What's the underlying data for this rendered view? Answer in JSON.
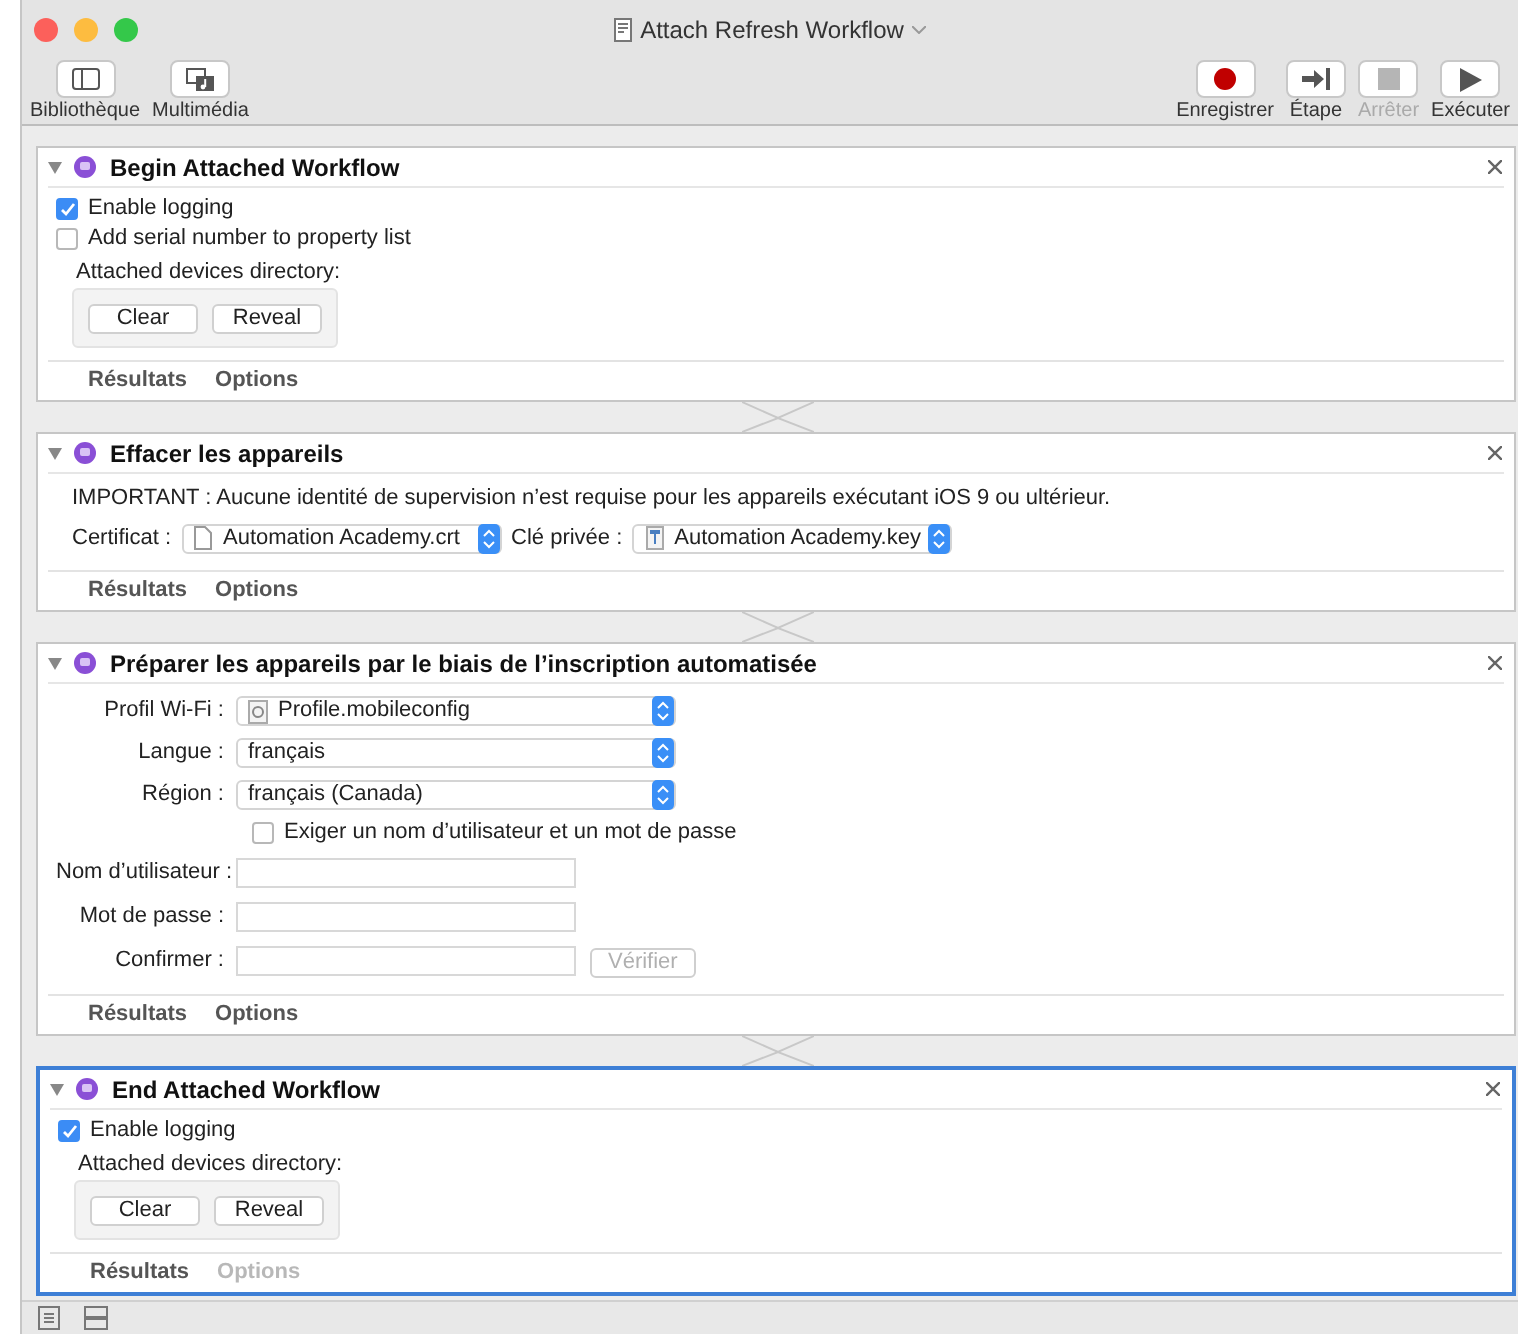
{
  "window": {
    "title": "Attach Refresh Workflow"
  },
  "toolbar_left": [
    {
      "label": "Bibliothèque",
      "kind": "library"
    },
    {
      "label": "Multimédia",
      "kind": "media"
    }
  ],
  "toolbar_right": [
    {
      "label": "Enregistrer",
      "kind": "record",
      "disabled": false
    },
    {
      "label": "Étape",
      "kind": "step",
      "disabled": false
    },
    {
      "label": "Arrêter",
      "kind": "stop",
      "disabled": true
    },
    {
      "label": "Exécuter",
      "kind": "run",
      "disabled": false
    }
  ],
  "actions": [
    {
      "title": "Begin Attached Workflow",
      "selected": false,
      "items": [
        {
          "kind": "checkbox",
          "label": "Enable logging",
          "checked": true
        },
        {
          "kind": "checkbox",
          "label": "Add serial number to property list",
          "checked": false
        },
        {
          "kind": "directory",
          "label": "Attached devices directory:",
          "buttons": [
            "Clear",
            "Reveal"
          ]
        }
      ],
      "tabs": [
        {
          "label": "Résultats",
          "disabled": false
        },
        {
          "label": "Options",
          "disabled": false
        }
      ]
    },
    {
      "title": "Effacer les appareils",
      "selected": false,
      "items": [
        {
          "kind": "text",
          "text": "IMPORTANT : Aucune identité de supervision n’est requise pour les appareils exécutant iOS 9 ou ultérieur."
        },
        {
          "kind": "popup-pair",
          "fields": [
            {
              "label": "Certificat :",
              "value": "Automation Academy.crt",
              "icon": {
                "kind": "document"
              }
            },
            {
              "label": "Clé privée :",
              "value": "Automation Academy.key",
              "icon": {
                "kind": "key"
              }
            }
          ]
        }
      ],
      "tabs": [
        {
          "label": "Résultats",
          "disabled": false
        },
        {
          "label": "Options",
          "disabled": false
        }
      ]
    },
    {
      "title": "Préparer les appareils par le biais de l’inscription automatisée",
      "selected": false,
      "items": [
        {
          "kind": "popup",
          "label": "Profil Wi-Fi :",
          "value": "Profile.mobileconfig",
          "icon": {
            "kind": "config"
          }
        },
        {
          "kind": "popup",
          "label": "Langue :",
          "value": "français"
        },
        {
          "kind": "popup",
          "label": "Région :",
          "value": "français (Canada)"
        },
        {
          "kind": "form-checkbox",
          "label": "Exiger un nom d’utilisateur et un mot de passe",
          "checked": false
        },
        {
          "kind": "field",
          "label": "Nom d’utilisateur :"
        },
        {
          "kind": "field",
          "label": "Mot de passe :"
        },
        {
          "kind": "field",
          "label": "Confirmer :",
          "button": {
            "label": "Vérifier",
            "disabled": true
          }
        }
      ],
      "tabs": [
        {
          "label": "Résultats",
          "disabled": false
        },
        {
          "label": "Options",
          "disabled": false
        }
      ]
    },
    {
      "title": "End Attached Workflow",
      "selected": true,
      "items": [
        {
          "kind": "checkbox",
          "label": "Enable logging",
          "checked": true
        },
        {
          "kind": "directory",
          "label": "Attached devices directory:",
          "buttons": [
            "Clear",
            "Reveal"
          ]
        }
      ],
      "tabs": [
        {
          "label": "Résultats",
          "disabled": false
        },
        {
          "label": "Options",
          "disabled": true
        }
      ]
    }
  ]
}
